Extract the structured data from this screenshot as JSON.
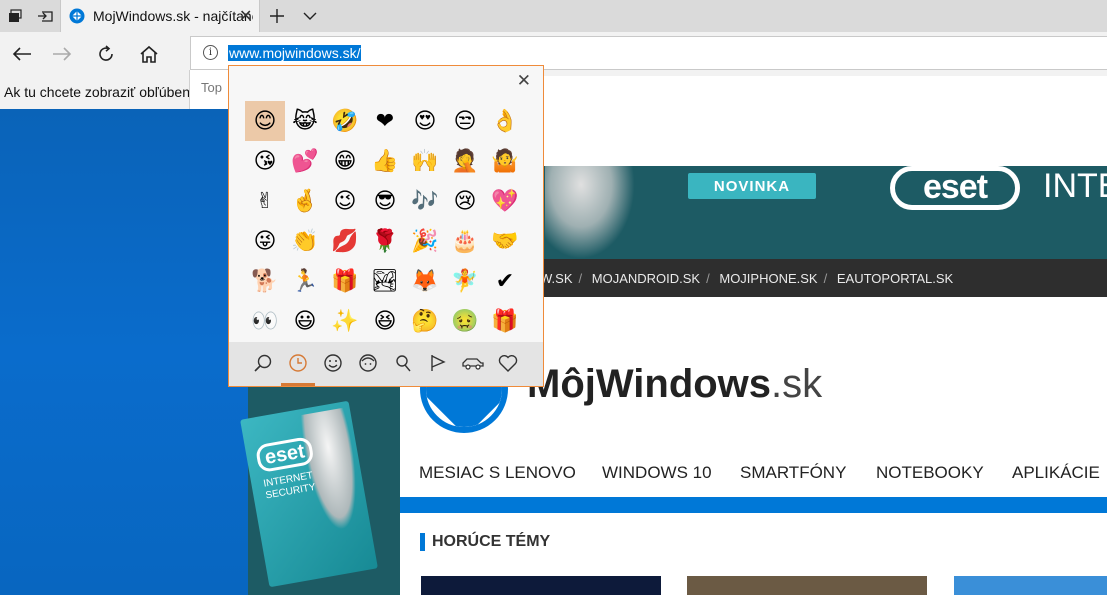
{
  "browser": {
    "tab_title": "MojWindows.sk - najčítanejší",
    "address_url": "www.mojwindows.sk/",
    "favorites_bar_text": "Ak tu chcete zobraziť obľúbené",
    "suggestions_label": "Top",
    "icons": [
      "tab-manager-icon",
      "set-aside-tabs-icon",
      "tab-close-icon",
      "new-tab-icon",
      "tab-list-chevron-icon",
      "back-icon",
      "forward-icon",
      "refresh-icon",
      "home-icon",
      "site-info-icon",
      "history-icon"
    ]
  },
  "emoji_panel": {
    "rows": [
      [
        "😊",
        "😹",
        "🤣",
        "❤",
        "😍",
        "😒",
        "👌"
      ],
      [
        "😘",
        "💕",
        "😁",
        "👍",
        "🙌",
        "🤦",
        "🤷"
      ],
      [
        "✌",
        "🤞",
        "😉",
        "😎",
        "🎶",
        "😢",
        "💖"
      ],
      [
        "😜",
        "👏",
        "💋",
        "🌹",
        "🎉",
        "🎂",
        "🤝"
      ],
      [
        "🐕",
        "🏃",
        "🎁",
        "🏞",
        "🦊",
        "🧚",
        "✔"
      ],
      [
        "👀",
        "😃",
        "✨",
        "😆",
        "🤔",
        "🤢",
        "🎁"
      ]
    ],
    "selected": [
      0,
      0
    ],
    "categories": [
      "search-icon",
      "recent-clock-icon",
      "smiley-icon",
      "people-icon",
      "places-pin-icon",
      "celebration-icon",
      "transport-car-icon",
      "heart-icon"
    ],
    "active_category": 1
  },
  "page": {
    "banner_badge": "NOVINKA",
    "banner_logo": "eset",
    "banner_text": "INTE",
    "top_links": [
      "W.SK",
      "MOJANDROID.SK",
      "MOJIPHONE.SK",
      "EAUTOPORTAL.SK"
    ],
    "logo_main": "MôjWindows",
    "logo_tld": ".sk",
    "nav_items": [
      "MESIAC S LENOVO",
      "WINDOWS 10",
      "SMARTFÓNY",
      "NOTEBOOKY",
      "APLIKÁCIE"
    ],
    "section_title": "HORÚCE TÉMY",
    "side_ad_logo": "eset",
    "side_ad_text": "INTERNET SECURITY"
  },
  "colors": {
    "accent": "#0078d7",
    "selection": "#ecc9a8",
    "panel_border": "#ef8b3a",
    "banner_teal": "#1d5b64",
    "badge_teal": "#3ab5c0"
  }
}
